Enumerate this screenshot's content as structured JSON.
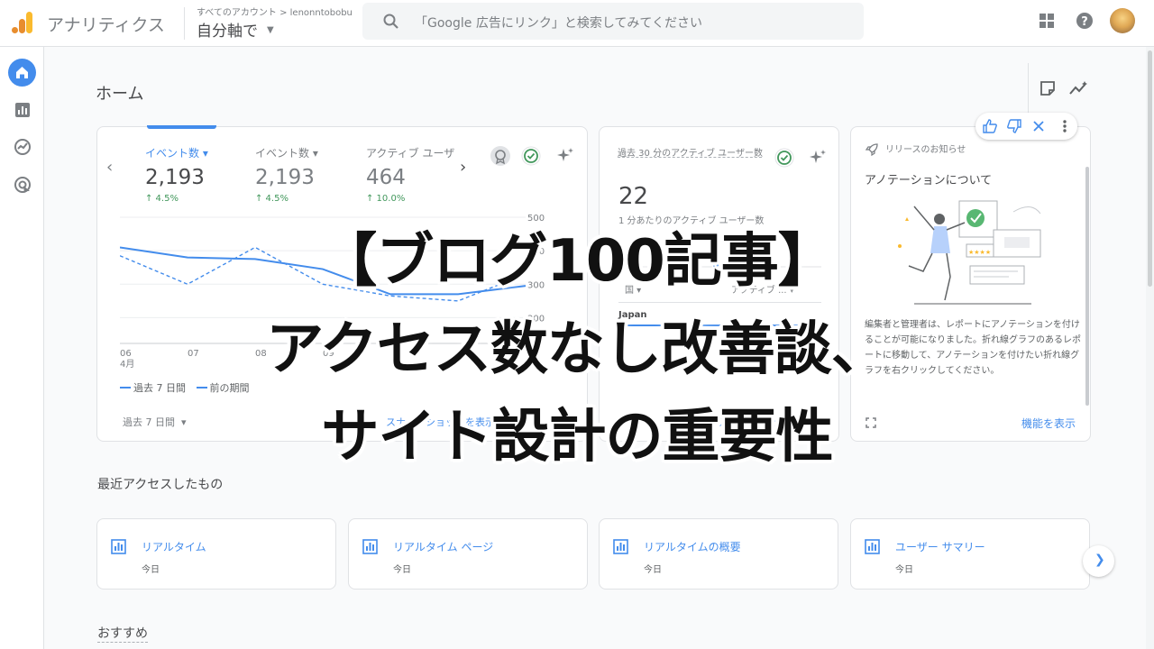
{
  "header": {
    "app_title": "アナリティクス",
    "account_crumb": "すべてのアカウント > lenonntobobu",
    "account_name": "自分軸で",
    "search_placeholder": "「Google 広告にリンク」と検索してみてください"
  },
  "page": {
    "title": "ホーム"
  },
  "main_card": {
    "metrics": [
      {
        "label": "イベント数 ▾",
        "value": "2,193",
        "delta": "↑ 4.5%"
      },
      {
        "label": "イベント数 ▾",
        "value": "2,193",
        "delta": "↑ 4.5%"
      },
      {
        "label": "アクティブ ユーザ",
        "value": "464",
        "delta": "↑ 10.0%"
      }
    ],
    "legend": {
      "current": "過去 7 日間",
      "previous": "前の期間"
    },
    "date_range": "過去 7 日間",
    "footer_link": "スナップショットを表示"
  },
  "chart_data": {
    "type": "line",
    "x": [
      "06",
      "07",
      "08",
      "09",
      "10",
      "11",
      "12"
    ],
    "x_sublabel": "4月",
    "ylim": [
      0,
      500
    ],
    "yticks": [
      "500",
      "400",
      "300",
      "200"
    ],
    "series": [
      {
        "name": "過去 7 日間",
        "values": [
          410,
          380,
          375,
          345,
          270,
          270,
          295
        ]
      },
      {
        "name": "前の期間",
        "values": [
          385,
          300,
          410,
          300,
          265,
          250,
          330
        ]
      }
    ],
    "colors": {
      "line": "#1a73e8"
    },
    "grid": true
  },
  "realtime_card": {
    "title": "過去 30 分のアクティブ ユーザー数",
    "value": "22",
    "subtitle": "1 分あたりのアクティブ ユーザー数",
    "col_country": "国 ▾",
    "col_active": "アクティブ ... ▾",
    "row_country": "Japan",
    "link": "リアルタイムを表示"
  },
  "announcement_card": {
    "header": "リリースのお知らせ",
    "title": "アノテーションについて",
    "body": "編集者と管理者は、レポートにアノテーションを付けることが可能になりました。折れ線グラフのあるレポートに移動して、アノテーションを付けたい折れ線グラフを右クリックしてください。",
    "link": "機能を表示"
  },
  "recent": {
    "title": "最近アクセスしたもの",
    "items": [
      {
        "title": "リアルタイム",
        "sub": "今日"
      },
      {
        "title": "リアルタイム ページ",
        "sub": "今日"
      },
      {
        "title": "リアルタイムの概要",
        "sub": "今日"
      },
      {
        "title": "ユーザー サマリー",
        "sub": "今日"
      }
    ]
  },
  "recommended": {
    "title": "おすすめ"
  },
  "overlay": {
    "line1": "【ブログ100記事】",
    "line2": "アクセス数なし改善談、",
    "line3": "サイト設計の重要性"
  },
  "icons": [
    "analytics-logo-icon",
    "search-icon",
    "apps-grid-icon",
    "help-icon",
    "home-icon",
    "reports-icon",
    "explore-icon",
    "advertising-icon",
    "settings-icon",
    "note-icon",
    "insights-icon",
    "badge-icon",
    "check-circle-icon",
    "sparkle-icon",
    "rocket-icon",
    "thumbs-up-icon",
    "thumbs-down-icon",
    "close-icon",
    "more-vert-icon",
    "expand-icon",
    "bar-chart-icon"
  ],
  "colors": {
    "accent": "#1a73e8",
    "positive": "#188038",
    "logo_orange": "#f9ab00",
    "logo_dark": "#e37400"
  }
}
